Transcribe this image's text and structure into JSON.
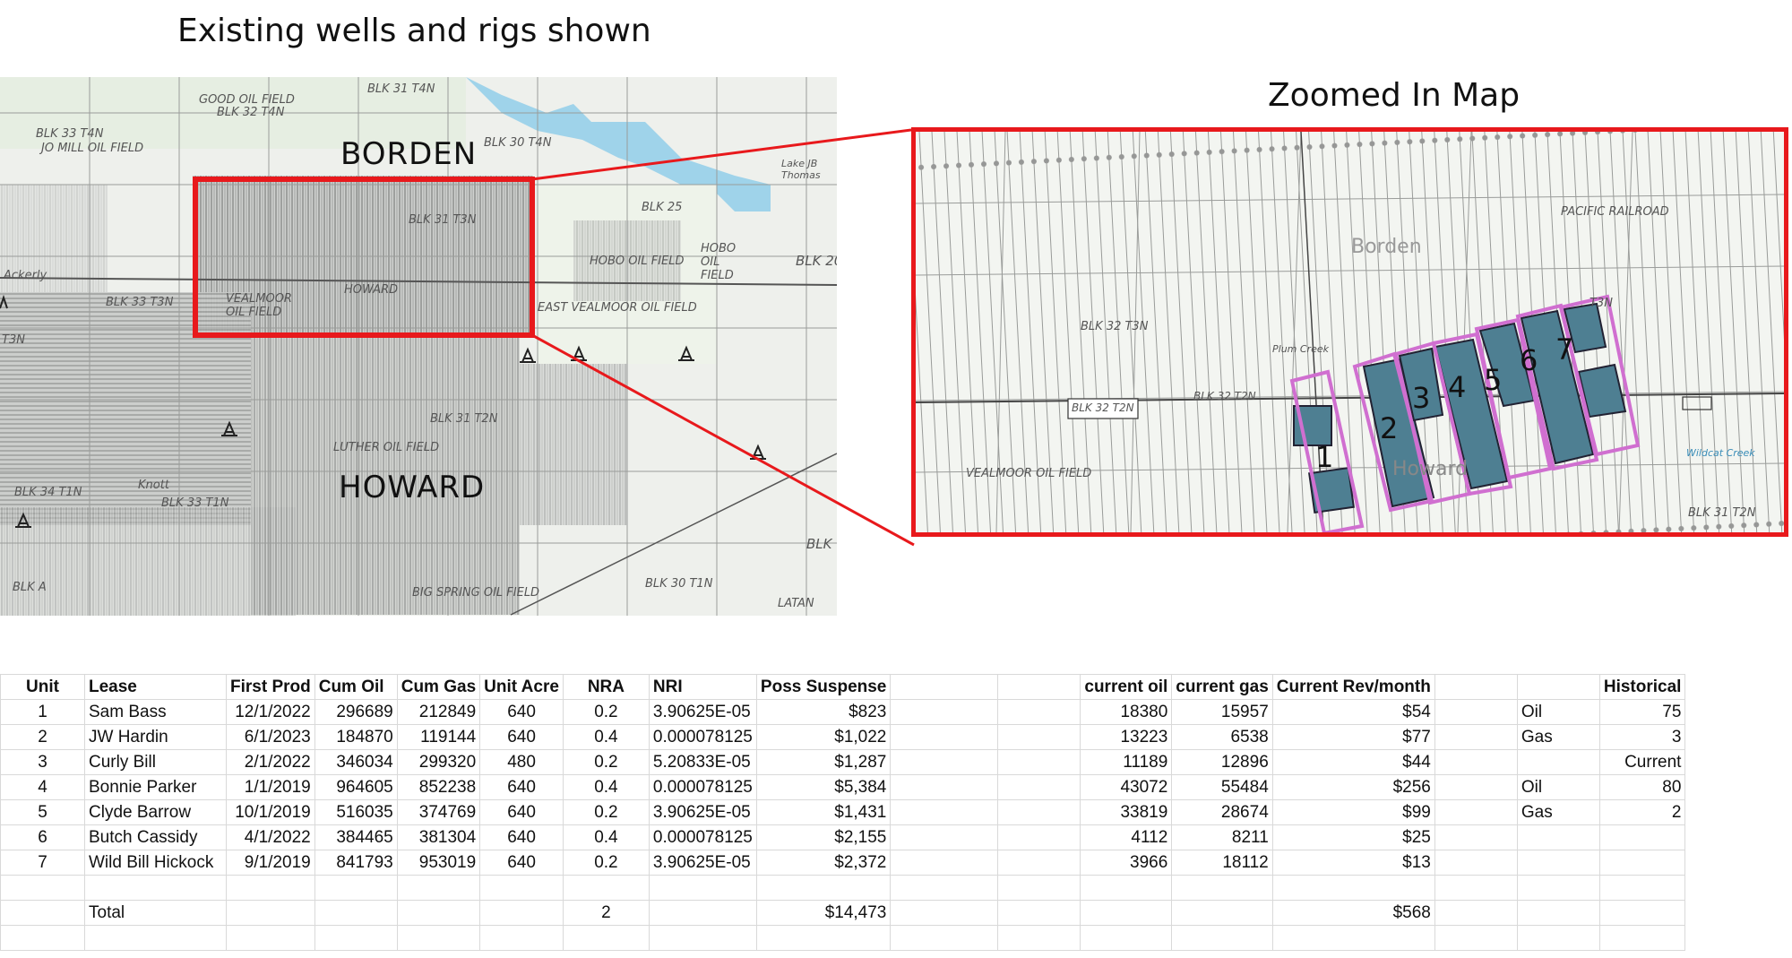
{
  "titles": {
    "left": "Existing wells and rigs shown",
    "right": "Zoomed In Map"
  },
  "left_map": {
    "counties": {
      "north": "BORDEN",
      "south": "HOWARD"
    },
    "labels": {
      "good_oil_field": "GOOD OIL FIELD",
      "blk32_t4n": "BLK 32 T4N",
      "blk31_t4n": "BLK 31 T4N",
      "blk33_t4n": "BLK 33 T4N",
      "jo_mill": "JO MILL OIL FIELD",
      "blk30_t4n": "BLK 30 T4N",
      "lake": "Lake JB Thomas",
      "blk25": "BLK 25",
      "blk31_t3n": "BLK 31 T3N",
      "hobo1": "HOBO OIL FIELD",
      "hobo2": "HOBO OIL FIELD",
      "blk20": "BLK 20",
      "ackerly": "Ackerly",
      "blk33_t3n": "BLK 33 T3N",
      "vealmoor": "VEALMOOR OIL FIELD",
      "howard_small": "HOWARD",
      "east_vealmoor": "EAST VEALMOOR OIL FIELD",
      "t3n": "T3N",
      "blk31_t2n": "BLK 31 T2N",
      "luther": "LUTHER OIL FIELD",
      "knott": "Knott",
      "blk34_t1n": "BLK 34 T1N",
      "blk33_t1n": "BLK 33 T1N",
      "big_spring": "BIG SPRING OIL FIELD",
      "blk30_t1n": "BLK 30 T1N",
      "blk_right": "BLK",
      "latan": "LATAN",
      "blk_a": "BLK A"
    }
  },
  "zoom_map": {
    "labels": {
      "borden": "Borden",
      "blk32_t3n": "BLK 32 T3N",
      "blk32_t2n": "BLK 32 T2N",
      "blk32_t2n_b": "BLK 32 T2N",
      "vealmoor": "VEALMOOR OIL FIELD",
      "blk31_t2n": "BLK 31 T2N",
      "t3n": "T3N",
      "pacific": "PACIFIC RAILROAD",
      "howard": "Howard",
      "plum_creek": "Plum Creek",
      "wildcat_creek": "Wildcat Creek"
    },
    "units": [
      "1",
      "2",
      "3",
      "4",
      "5",
      "6",
      "7"
    ]
  },
  "table": {
    "headers": [
      "Unit",
      "Lease",
      "First Prod",
      "Cum Oil",
      "Cum Gas",
      "Unit Acre",
      "NRA",
      "NRI",
      "Poss Suspense",
      "",
      "",
      "current oil",
      "current gas",
      "Current Rev/month",
      "",
      "",
      "Historical"
    ],
    "rows": [
      [
        "1",
        "Sam Bass",
        "12/1/2022",
        "296689",
        "212849",
        "640",
        "0.2",
        "3.90625E-05",
        "$823",
        "",
        "",
        "18380",
        "15957",
        "$54",
        "",
        "Oil",
        "75"
      ],
      [
        "2",
        "JW Hardin",
        "6/1/2023",
        "184870",
        "119144",
        "640",
        "0.4",
        "0.000078125",
        "$1,022",
        "",
        "",
        "13223",
        "6538",
        "$77",
        "",
        "Gas",
        "3"
      ],
      [
        "3",
        "Curly Bill",
        "2/1/2022",
        "346034",
        "299320",
        "480",
        "0.2",
        "5.20833E-05",
        "$1,287",
        "",
        "",
        "11189",
        "12896",
        "$44",
        "",
        "",
        "Current"
      ],
      [
        "4",
        "Bonnie Parker",
        "1/1/2019",
        "964605",
        "852238",
        "640",
        "0.4",
        "0.000078125",
        "$5,384",
        "",
        "",
        "43072",
        "55484",
        "$256",
        "",
        "Oil",
        "80"
      ],
      [
        "5",
        "Clyde Barrow",
        "10/1/2019",
        "516035",
        "374769",
        "640",
        "0.2",
        "3.90625E-05",
        "$1,431",
        "",
        "",
        "33819",
        "28674",
        "$99",
        "",
        "Gas",
        "2"
      ],
      [
        "6",
        "Butch Cassidy",
        "4/1/2022",
        "384465",
        "381304",
        "640",
        "0.4",
        "0.000078125",
        "$2,155",
        "",
        "",
        "4112",
        "8211",
        "$25",
        "",
        "",
        ""
      ],
      [
        "7",
        "Wild Bill Hickock",
        "9/1/2019",
        "841793",
        "953019",
        "640",
        "0.2",
        "3.90625E-05",
        "$2,372",
        "",
        "",
        "3966",
        "18112",
        "$13",
        "",
        "",
        ""
      ],
      [
        "",
        "",
        "",
        "",
        "",
        "",
        "",
        "",
        "",
        "",
        "",
        "",
        "",
        "",
        "",
        "",
        ""
      ],
      [
        "",
        "Total",
        "",
        "",
        "",
        "",
        "2",
        "",
        "$14,473",
        "",
        "",
        "",
        "",
        "$568",
        "",
        "",
        ""
      ],
      [
        "",
        "",
        "",
        "",
        "",
        "",
        "",
        "",
        "",
        "",
        "",
        "",
        "",
        "",
        "",
        "",
        ""
      ]
    ]
  },
  "colors": {
    "highlight_red": "#e8191c",
    "unit_fill": "#4e7f92",
    "unit_outline": "#d06fd0",
    "water": "#9fd3ea"
  }
}
